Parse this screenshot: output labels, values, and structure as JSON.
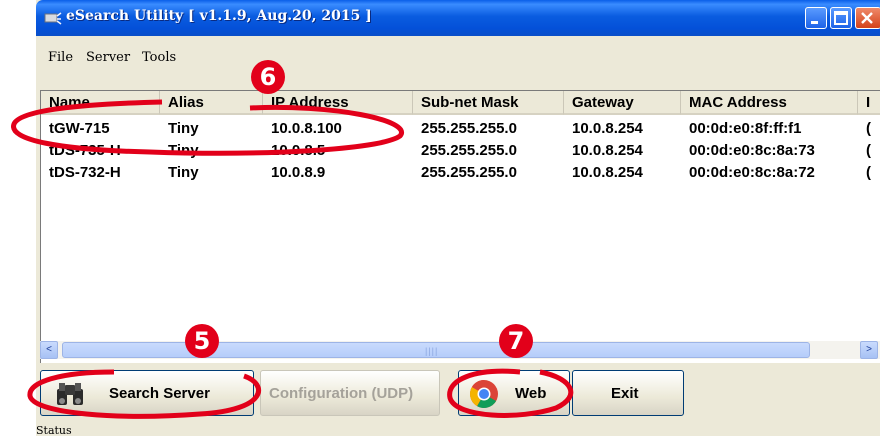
{
  "window": {
    "title": "eSearch Utility [ v1.1.9, Aug.20, 2015 ]",
    "icons": [
      "app-icon",
      "minimize-icon",
      "maximize-icon",
      "close-icon"
    ]
  },
  "menu": {
    "items": [
      {
        "label": "File"
      },
      {
        "label": "Server"
      },
      {
        "label": "Tools"
      }
    ]
  },
  "table": {
    "columns": [
      "Name",
      "Alias",
      "IP Address",
      "Sub-net Mask",
      "Gateway",
      "MAC Address",
      "I"
    ],
    "rows": [
      {
        "name": "tGW-715",
        "alias": "Tiny",
        "ip": "10.0.8.100",
        "mask": "255.255.255.0",
        "gateway": "10.0.8.254",
        "mac": "00:0d:e0:8f:ff:f1",
        "extra": "("
      },
      {
        "name": "tDS-735-H",
        "alias": "Tiny",
        "ip": "10.0.8.5",
        "mask": "255.255.255.0",
        "gateway": "10.0.8.254",
        "mac": "00:0d:e0:8c:8a:73",
        "extra": "("
      },
      {
        "name": "tDS-732-H",
        "alias": "Tiny",
        "ip": "10.0.8.9",
        "mask": "255.255.255.0",
        "gateway": "10.0.8.254",
        "mac": "00:0d:e0:8c:8a:72",
        "extra": "("
      }
    ]
  },
  "scrollbar": {
    "left_arrow": "<",
    "right_arrow": ">",
    "grip": "||||"
  },
  "buttons": {
    "search_server": "Search Server",
    "configuration": "Configuration (UDP)",
    "web": "Web",
    "exit": "Exit"
  },
  "status": {
    "text": "Status"
  },
  "annotations": {
    "badges": [
      "5",
      "6",
      "7"
    ],
    "color": "#e2001a"
  }
}
